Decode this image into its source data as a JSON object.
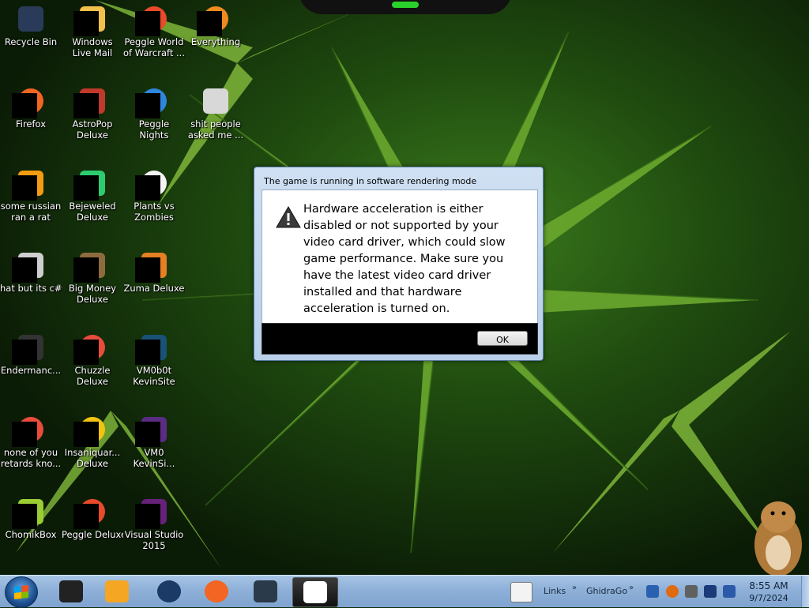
{
  "desktop": {
    "icons": [
      {
        "label": "Recycle Bin",
        "icon": "recycle-bin-icon",
        "color": "#2a3b5a"
      },
      {
        "label": "Windows Live Mail",
        "icon": "mail-icon",
        "color": "#f0c04a"
      },
      {
        "label": "Peggle World of Warcraft ...",
        "icon": "peggle-icon",
        "color": "#e84a2a"
      },
      {
        "label": "Everything",
        "icon": "search-icon",
        "color": "#f08a20"
      },
      {
        "label": "Firefox",
        "icon": "firefox-icon",
        "color": "#f26522"
      },
      {
        "label": "AstroPop Deluxe",
        "icon": "astropop-icon",
        "color": "#c0392b"
      },
      {
        "label": "Peggle Nights Deluxe",
        "icon": "peggle-nights-icon",
        "color": "#2e86de"
      },
      {
        "label": "shit people asked me ...",
        "icon": "folder-icon",
        "color": "#d8d8d8"
      },
      {
        "label": "some russian ran a rat",
        "icon": "app-icon",
        "color": "#f39c12"
      },
      {
        "label": "Bejeweled Deluxe",
        "icon": "bejeweled-icon",
        "color": "#2ecc71"
      },
      {
        "label": "Plants vs Zombies",
        "icon": "plants-icon",
        "color": "#f5f5f5"
      },
      {
        "label": "hat but its c#",
        "icon": "copy-icon",
        "color": "#cfcfcf"
      },
      {
        "label": "Big Money Deluxe",
        "icon": "money-icon",
        "color": "#8e6b3f"
      },
      {
        "label": "Zuma Deluxe",
        "icon": "zuma-icon",
        "color": "#e67e22"
      },
      {
        "label": "Endermanc...",
        "icon": "terminal-icon",
        "color": "#333333"
      },
      {
        "label": "Chuzzle Deluxe",
        "icon": "chuzzle-icon",
        "color": "#e74c3c"
      },
      {
        "label": "VM0b0t KevinSite",
        "icon": "vm-icon",
        "color": "#1a5276"
      },
      {
        "label": "none of you retards kno...",
        "icon": "chrome-icon",
        "color": "#e74c3c"
      },
      {
        "label": "Insaniquar... Deluxe",
        "icon": "fish-icon",
        "color": "#f1c40f"
      },
      {
        "label": "VM0 KevinSi...",
        "icon": "vm-icon",
        "color": "#5b2c83"
      },
      {
        "label": "ChomikBox",
        "icon": "chomikbox-icon",
        "color": "#9acd32"
      },
      {
        "label": "Peggle Deluxe",
        "icon": "peggle-icon",
        "color": "#e84a2a"
      },
      {
        "label": "Visual Studio 2015",
        "icon": "visual-studio-icon",
        "color": "#68217a"
      }
    ]
  },
  "dialog": {
    "title": "The game is running in software rendering mode",
    "message": "Hardware acceleration is either disabled or not supported by your video card driver, which could slow game performance. Make sure you have the latest video card driver installed and that hardware acceleration is turned on.",
    "ok_label": "OK",
    "icon": "warning-icon"
  },
  "taskbar": {
    "start_icon": "windows-start-icon",
    "apps": [
      {
        "icon": "explorer-icon",
        "color": "#222222",
        "active": false
      },
      {
        "icon": "media-player-icon",
        "color": "#f5a623",
        "active": false
      },
      {
        "icon": "globe-icon",
        "color": "#1b3a66",
        "active": false
      },
      {
        "icon": "firefox-icon",
        "color": "#f26522",
        "active": false
      },
      {
        "icon": "monitor-icon",
        "color": "#2b3a4a",
        "active": false
      },
      {
        "icon": "cards-game-icon",
        "color": "#ffffff",
        "active": true
      }
    ],
    "links_label": "Links",
    "ghidra_label": "GhidraGo",
    "tray_icons": [
      {
        "icon": "network-icon",
        "color": "#2a60b0"
      },
      {
        "icon": "search-icon",
        "color": "#e06a10"
      },
      {
        "icon": "settings-icon",
        "color": "#606060"
      },
      {
        "icon": "display-icon",
        "color": "#1a3a7a"
      },
      {
        "icon": "volume-icon",
        "color": "#2a5aa8"
      }
    ],
    "clock_time": "8:55 AM",
    "clock_date": "9/7/2024"
  }
}
